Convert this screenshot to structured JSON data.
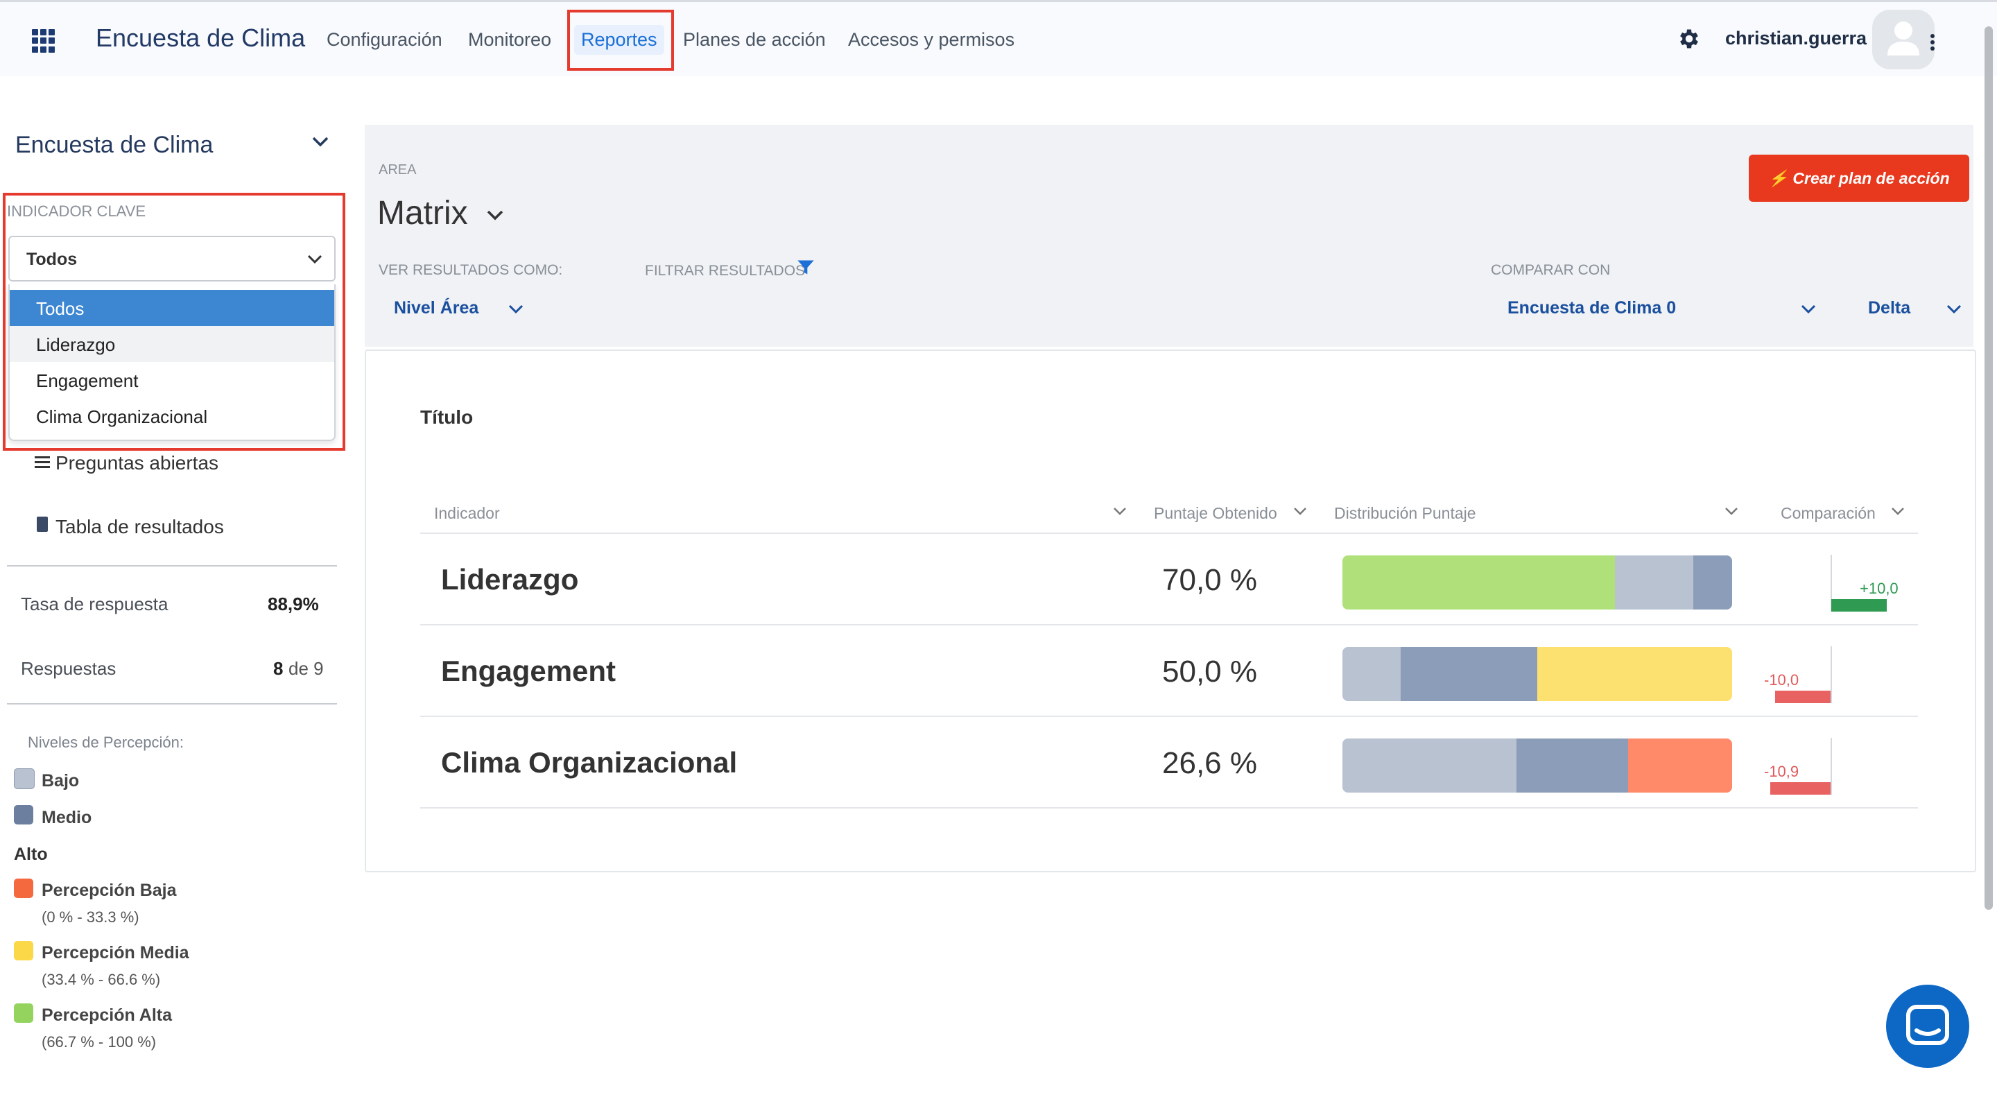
{
  "header": {
    "app_title": "Encuesta de Clima",
    "nav": [
      "Configuración",
      "Monitoreo",
      "Reportes",
      "Planes de acción",
      "Accesos y permisos"
    ],
    "active_nav": "Reportes",
    "username": "christian.guerra",
    "icons": {
      "apps": "grid-icon",
      "settings": "gear-icon",
      "avatar": "user-avatar-icon",
      "menu": "kebab-icon"
    }
  },
  "sidebar": {
    "title": "Encuesta de Clima",
    "kpi_label": "INDICADOR CLAVE",
    "select_value": "Todos",
    "options": [
      "Todos",
      "Liderazgo",
      "Engagement",
      "Clima Organizacional"
    ],
    "links": [
      "Preguntas abiertas",
      "Tabla de resultados"
    ],
    "stats": {
      "tasa_label": "Tasa de respuesta",
      "tasa_value": "88,9%",
      "resp_label": "Respuestas",
      "resp_value": "8",
      "resp_of": "de 9"
    },
    "legend": {
      "heading": "Niveles de Percepción:",
      "bajo": "Bajo",
      "medio": "Medio",
      "alto": "Alto",
      "items": [
        {
          "label": "Percepción Baja",
          "range": "(0 % - 33.3 %)",
          "color": "#f5693f"
        },
        {
          "label": "Percepción Media",
          "range": "(33.4 % - 66.6 %)",
          "color": "#fbd847"
        },
        {
          "label": "Percepción Alta",
          "range": "(66.7 % - 100 %)",
          "color": "#94d35e"
        }
      ],
      "bajo_color": "#b8c2d1",
      "medio_color": "#6c7f9e"
    }
  },
  "main": {
    "area_label": "AREA",
    "area_value": "Matrix",
    "ver_label": "VER RESULTADOS COMO:",
    "ver_value": "Nivel Área",
    "filtrar_label": "FILTRAR RESULTADOS",
    "comparar_label": "COMPARAR CON",
    "comparar_value": "Encuesta de Clima 0",
    "delta_value": "Delta",
    "btn_plan": "Crear plan de acción",
    "card_title": "Título",
    "columns": [
      "Indicador",
      "Puntaje Obtenido",
      "Distribución Puntaje",
      "Comparación"
    ],
    "rows": [
      {
        "name": "Liderazgo",
        "score": "70,0 %",
        "cmp": "+10,0",
        "cmp_value": 10.0,
        "segments": [
          {
            "pct": 70,
            "color": "#b0e07a"
          },
          {
            "pct": 20,
            "color": "#b8c2d1"
          },
          {
            "pct": 10,
            "color": "#8b9db8"
          }
        ]
      },
      {
        "name": "Engagement",
        "score": "50,0 %",
        "cmp": "-10,0",
        "cmp_value": -10.0,
        "segments": [
          {
            "pct": 15,
            "color": "#b8c2d1"
          },
          {
            "pct": 35,
            "color": "#8b9db8"
          },
          {
            "pct": 50,
            "color": "#fde170"
          }
        ]
      },
      {
        "name": "Clima Organizacional",
        "score": "26,6 %",
        "cmp": "-10,9",
        "cmp_value": -10.9,
        "segments": [
          {
            "pct": 44.6,
            "color": "#b8c2d1"
          },
          {
            "pct": 28.8,
            "color": "#8b9db8"
          },
          {
            "pct": 26.6,
            "color": "#fe8a6a"
          }
        ]
      }
    ]
  }
}
